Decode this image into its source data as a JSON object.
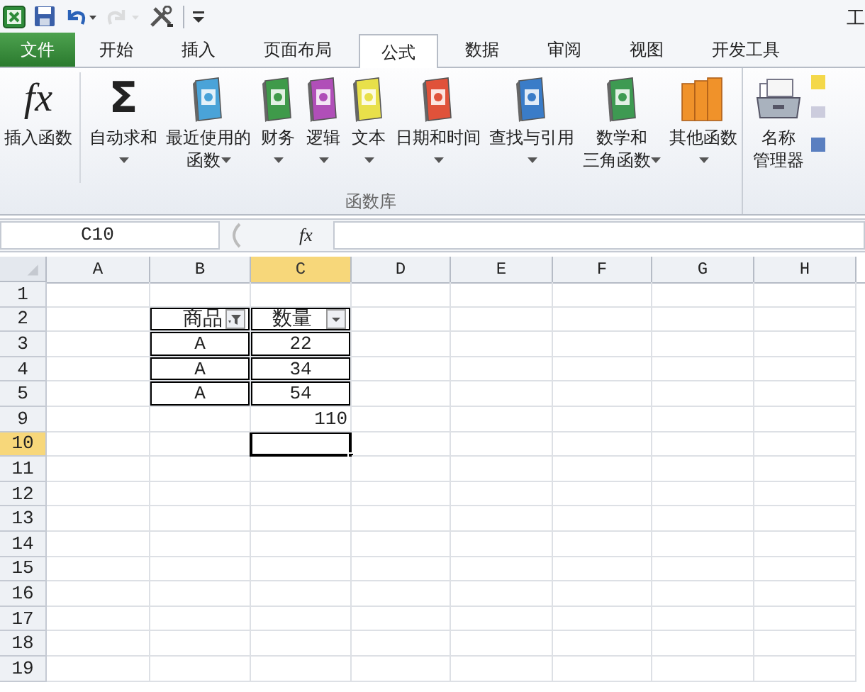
{
  "quick_access": [
    {
      "kind": "excel",
      "disabled": false
    },
    {
      "kind": "save",
      "disabled": false
    },
    {
      "kind": "undo",
      "disabled": false
    },
    {
      "kind": "redo",
      "disabled": true
    },
    {
      "kind": "tools",
      "disabled": false
    },
    {
      "kind": "customize",
      "disabled": false
    }
  ],
  "window": {
    "title": "工"
  },
  "tabs": [
    {
      "label": "文件",
      "kind": "file",
      "selected": false
    },
    {
      "label": "开始",
      "kind": "tab",
      "selected": false
    },
    {
      "label": "插入",
      "kind": "tab",
      "selected": false
    },
    {
      "label": "页面布局",
      "kind": "tab",
      "selected": false
    },
    {
      "label": "公式",
      "kind": "tab",
      "selected": true
    },
    {
      "label": "数据",
      "kind": "tab",
      "selected": false
    },
    {
      "label": "审阅",
      "kind": "tab",
      "selected": false
    },
    {
      "label": "视图",
      "kind": "tab",
      "selected": false
    },
    {
      "label": "开发工具",
      "kind": "tab",
      "selected": false
    }
  ],
  "ribbon": {
    "groups": [
      {
        "label": "函数库",
        "buttons": [
          {
            "kind": "glyph",
            "glyph": "fx",
            "lines": [
              "插入函数"
            ],
            "dropdown": false,
            "separator_after": true
          },
          {
            "kind": "glyph",
            "glyph": "Σ",
            "lines": [
              "自动求和"
            ],
            "dropdown": true
          },
          {
            "kind": "book",
            "color": "#4aa3d8",
            "lines": [
              "最近使用的",
              "函数"
            ],
            "dropdown": true
          },
          {
            "kind": "book",
            "color": "#3f9a4a",
            "lines": [
              "财务"
            ],
            "dropdown": true
          },
          {
            "kind": "book",
            "color": "#b04fb8",
            "lines": [
              "逻辑"
            ],
            "dropdown": true
          },
          {
            "kind": "book",
            "color": "#e8e04a",
            "lines": [
              "文本"
            ],
            "dropdown": true
          },
          {
            "kind": "book",
            "color": "#e0523a",
            "lines": [
              "日期和时间"
            ],
            "dropdown": true
          },
          {
            "kind": "book",
            "color": "#3a7cc8",
            "lines": [
              "查找与引用"
            ],
            "dropdown": true
          },
          {
            "kind": "book",
            "color": "#3e9a52",
            "lines": [
              "数学和",
              "三角函数"
            ],
            "dropdown": true
          },
          {
            "kind": "books",
            "color": "#f0922a",
            "lines": [
              "其他函数"
            ],
            "dropdown": true
          }
        ]
      },
      {
        "buttons": [
          {
            "kind": "cabinet",
            "lines": [
              "名称",
              "管理器"
            ],
            "dropdown": false
          }
        ]
      }
    ]
  },
  "formula_bar": {
    "name_box": "C10",
    "fx": "fx"
  },
  "sheet": {
    "columns": [
      {
        "label": "A",
        "selected": false
      },
      {
        "label": "B",
        "selected": false
      },
      {
        "label": "C",
        "selected": true
      },
      {
        "label": "D",
        "selected": false
      },
      {
        "label": "E",
        "selected": false
      },
      {
        "label": "F",
        "selected": false
      },
      {
        "label": "G",
        "selected": false
      },
      {
        "label": "H",
        "selected": false
      }
    ],
    "rows": [
      {
        "label": "1",
        "selected": false,
        "cells": [
          {},
          {},
          {},
          {},
          {},
          {},
          {},
          {}
        ]
      },
      {
        "label": "2",
        "selected": false,
        "cells": [
          {},
          {
            "kind": "filter_header",
            "text": "商品",
            "bordered": true,
            "centered": false,
            "filtered": true
          },
          {
            "kind": "filter_header",
            "text": "数量",
            "bordered": true,
            "centered": true,
            "filtered": false
          },
          {},
          {},
          {},
          {},
          {}
        ]
      },
      {
        "label": "3",
        "selected": false,
        "cells": [
          {},
          {
            "text": "A",
            "bordered": true,
            "centered": true
          },
          {
            "text": "22",
            "bordered": true,
            "centered": true
          },
          {},
          {},
          {},
          {},
          {}
        ]
      },
      {
        "label": "4",
        "selected": false,
        "cells": [
          {},
          {
            "text": "A",
            "bordered": true,
            "centered": true
          },
          {
            "text": "34",
            "bordered": true,
            "centered": true
          },
          {},
          {},
          {},
          {},
          {}
        ]
      },
      {
        "label": "5",
        "selected": false,
        "cells": [
          {},
          {
            "text": "A",
            "bordered": true,
            "centered": true
          },
          {
            "text": "54",
            "bordered": true,
            "centered": true
          },
          {},
          {},
          {},
          {},
          {}
        ]
      },
      {
        "label": "9",
        "selected": false,
        "cells": [
          {},
          {},
          {
            "text": "110",
            "centered": false
          },
          {},
          {},
          {},
          {},
          {}
        ]
      },
      {
        "label": "10",
        "selected": true,
        "cells": [
          {},
          {},
          {
            "selected": true
          },
          {},
          {},
          {},
          {},
          {}
        ]
      },
      {
        "label": "11",
        "selected": false,
        "cells": [
          {},
          {},
          {},
          {},
          {},
          {},
          {},
          {}
        ]
      },
      {
        "label": "12",
        "selected": false,
        "cells": [
          {},
          {},
          {},
          {},
          {},
          {},
          {},
          {}
        ]
      },
      {
        "label": "13",
        "selected": false,
        "cells": [
          {},
          {},
          {},
          {},
          {},
          {},
          {},
          {}
        ]
      },
      {
        "label": "14",
        "selected": false,
        "cells": [
          {},
          {},
          {},
          {},
          {},
          {},
          {},
          {}
        ]
      },
      {
        "label": "15",
        "selected": false,
        "cells": [
          {},
          {},
          {},
          {},
          {},
          {},
          {},
          {}
        ]
      },
      {
        "label": "16",
        "selected": false,
        "cells": [
          {},
          {},
          {},
          {},
          {},
          {},
          {},
          {}
        ]
      },
      {
        "label": "17",
        "selected": false,
        "cells": [
          {},
          {},
          {},
          {},
          {},
          {},
          {},
          {}
        ]
      },
      {
        "label": "18",
        "selected": false,
        "cells": [
          {},
          {},
          {},
          {},
          {},
          {},
          {},
          {}
        ]
      },
      {
        "label": "19",
        "selected": false,
        "cells": [
          {},
          {},
          {},
          {},
          {},
          {},
          {},
          {}
        ]
      }
    ]
  }
}
